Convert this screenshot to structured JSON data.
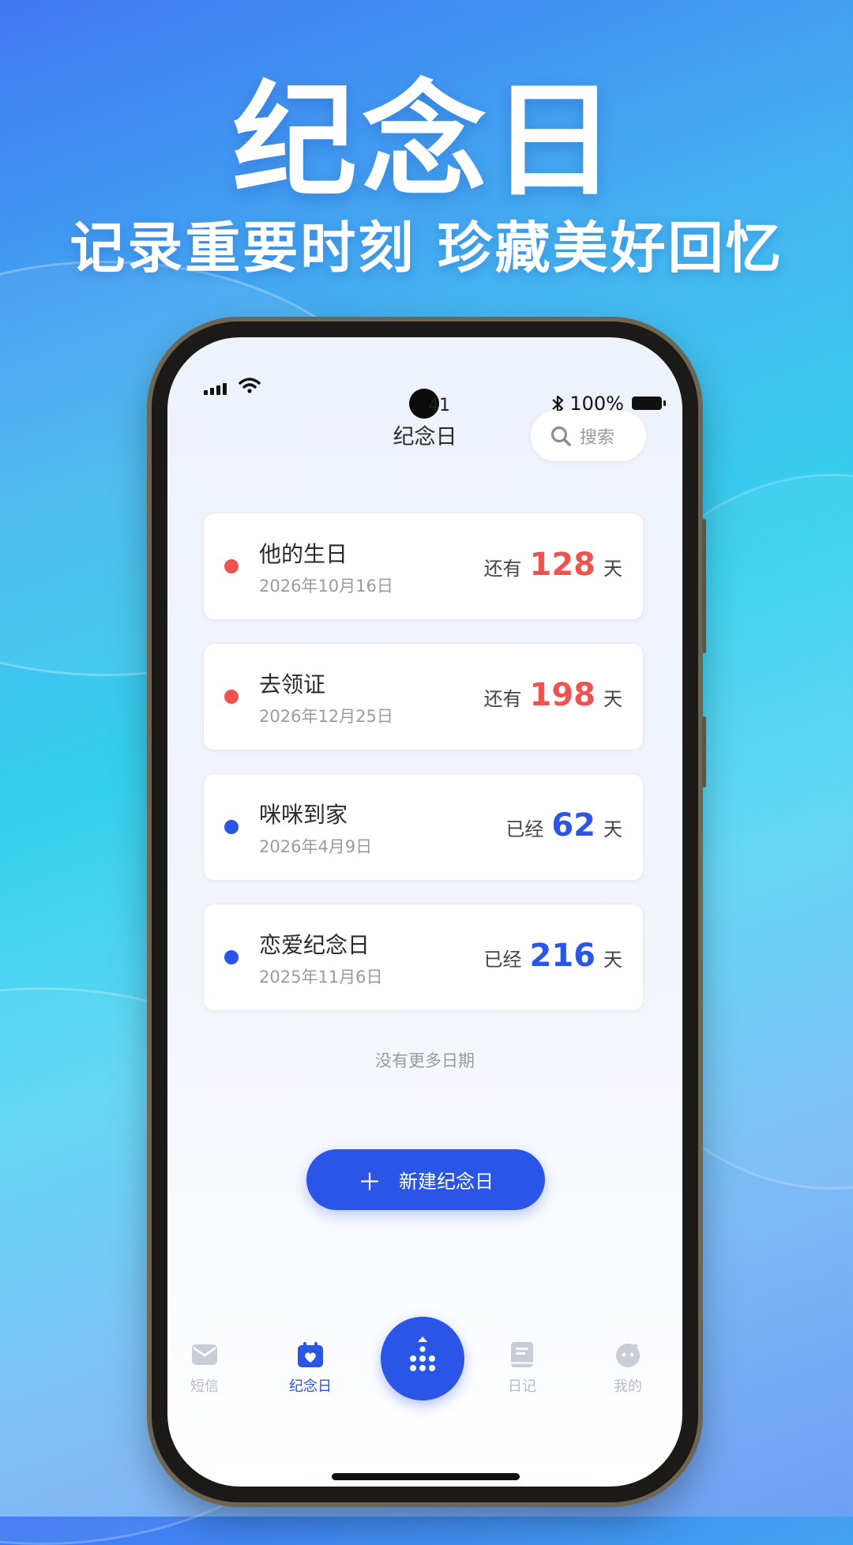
{
  "hero": {
    "title": "纪念日",
    "subtitle": "记录重要时刻 珍藏美好回忆"
  },
  "status_bar": {
    "time": "41",
    "battery": "100%"
  },
  "nav": {
    "title": "纪念日",
    "search_placeholder": "搜索"
  },
  "events": [
    {
      "title": "他的生日",
      "date": "2026年10月16日",
      "label": "还有",
      "days": "128",
      "unit": "天",
      "color": "#ee5350"
    },
    {
      "title": "去领证",
      "date": "2026年12月25日",
      "label": "还有",
      "days": "198",
      "unit": "天",
      "color": "#ee5350"
    },
    {
      "title": "咪咪到家",
      "date": "2026年4月9日",
      "label": "已经",
      "days": "62",
      "unit": "天",
      "color": "#2a55e6"
    },
    {
      "title": "恋爱纪念日",
      "date": "2025年11月6日",
      "label": "已经",
      "days": "216",
      "unit": "天",
      "color": "#2a55e6"
    }
  ],
  "list_footer": "没有更多日期",
  "new_button": {
    "icon": "plus-icon",
    "label": "新建纪念日"
  },
  "tabs": [
    {
      "label": "短信",
      "icon": "mail-icon",
      "active": false
    },
    {
      "label": "纪念日",
      "icon": "calendar-heart-icon",
      "active": true
    },
    {
      "label": "",
      "icon": "apps-icon",
      "active": false
    },
    {
      "label": "日记",
      "icon": "book-icon",
      "active": false
    },
    {
      "label": "我的",
      "icon": "profile-icon",
      "active": false
    }
  ],
  "colors": {
    "accent": "#2a55e6",
    "countdown": "#ee5350"
  }
}
